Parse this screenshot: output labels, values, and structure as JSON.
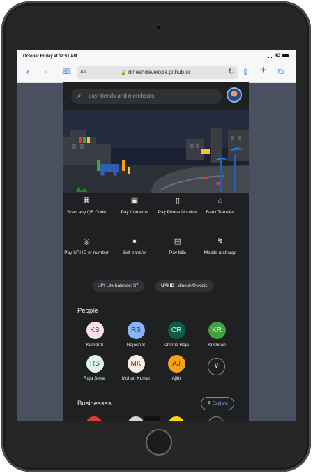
{
  "status_bar": {
    "time": "October Friday at 12:51 AM",
    "network": "4G"
  },
  "browser": {
    "text_size_label": "AA",
    "url": "dineshdevelope.github.io"
  },
  "search": {
    "placeholder": "pay friends and merchants"
  },
  "actions": [
    {
      "label": "Scan any QR Code",
      "icon": "qr-scan-icon",
      "glyph": "⌘"
    },
    {
      "label": "Pay Contents",
      "icon": "contacts-icon",
      "glyph": "▣"
    },
    {
      "label": "Pay Phone Number",
      "icon": "phone-icon",
      "glyph": "▯"
    },
    {
      "label": "Bank Transfer",
      "icon": "bank-icon",
      "glyph": "⌂"
    },
    {
      "label": "Pay UPI ID or number",
      "icon": "upi-icon",
      "glyph": "◎"
    },
    {
      "label": "Self transfer",
      "icon": "person-icon",
      "glyph": "●"
    },
    {
      "label": "Pay bills",
      "icon": "bill-icon",
      "glyph": "▤"
    },
    {
      "label": "Mobile recharge",
      "icon": "recharge-icon",
      "glyph": "↯"
    }
  ],
  "upi": {
    "lite_balance": "UPI Lite balance: $7",
    "id_label": "UPI ID",
    "id_value": ": dinesh@okicici"
  },
  "people": {
    "title": "People",
    "items": [
      {
        "initials": "KS",
        "name": "Kumar S",
        "bg": "#f9e3e6",
        "fg": "#5f3940"
      },
      {
        "initials": "RS",
        "name": "Rajesh S",
        "bg": "#8ab4f8",
        "fg": "#1e3a6b"
      },
      {
        "initials": "CR",
        "name": "Chinna Raja",
        "bg": "#0d5c45",
        "fg": "#d9f0e6"
      },
      {
        "initials": "KR",
        "name": "Krishnan",
        "bg": "#3fa33f",
        "fg": "#e8ffe8"
      },
      {
        "initials": "RS",
        "name": "Raja Sekar",
        "bg": "#e0f2ec",
        "fg": "#2d4a40"
      },
      {
        "initials": "MK",
        "name": "Mohan Kumar",
        "bg": "#fbeee0",
        "fg": "#5a4330"
      },
      {
        "initials": "AJ",
        "name": "Ajith",
        "bg": "#f6a11a",
        "fg": "#4a2a00"
      }
    ],
    "more_icon": "chevron-down-icon"
  },
  "businesses": {
    "title": "Businesses",
    "explore_label": "Explore"
  },
  "colors": {
    "page_bg": "#1f2022",
    "accent": "#8ab4f8",
    "browser_blue": "#1a73e8"
  }
}
